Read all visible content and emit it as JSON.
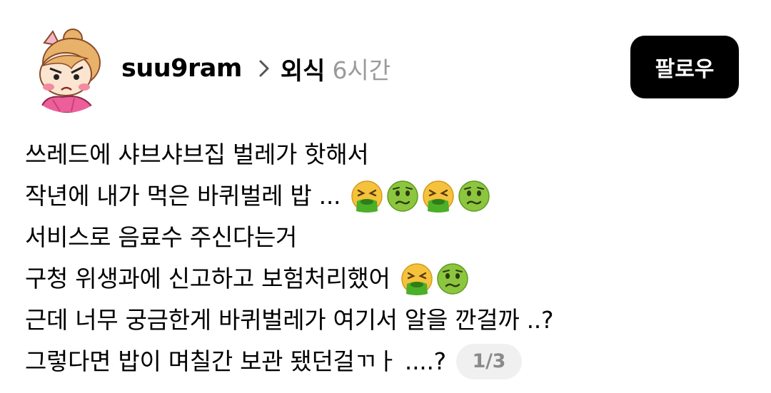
{
  "author": {
    "username": "suu9ram",
    "topic": "외식",
    "time": "6시간",
    "avatar_icon": "cartoon-girl-avatar-icon"
  },
  "follow_button": {
    "label": "팔로우"
  },
  "post": {
    "lines": [
      {
        "text": "쓰레드에 샤브샤브집 벌레가 핫해서",
        "emojis": []
      },
      {
        "text": "작년에 내가 먹은 바퀴벌레 밥 ...",
        "emojis": [
          "vomiting-face-icon",
          "nauseated-face-icon",
          "vomiting-face-icon",
          "nauseated-face-icon"
        ]
      },
      {
        "text": "서비스로 음료수 주신다는거",
        "emojis": []
      },
      {
        "text": "구청 위생과에 신고하고 보험처리했어",
        "emojis": [
          "vomiting-face-icon",
          "nauseated-face-icon"
        ]
      },
      {
        "text": "근데 너무 궁금한게 바퀴벌레가 여기서 알을 깐걸까 ..?",
        "emojis": []
      },
      {
        "text": "그렇다면 밥이 며칠간 보관 됐던걸ㄲㅏ ....?",
        "emojis": []
      }
    ],
    "page_indicator": "1/3"
  },
  "colors": {
    "follow_bg": "#000000",
    "time_text": "#9a9a9a",
    "indicator_bg": "#f0f0f0",
    "emoji_face": "#8cc63e",
    "vomit": "#4caf28"
  }
}
